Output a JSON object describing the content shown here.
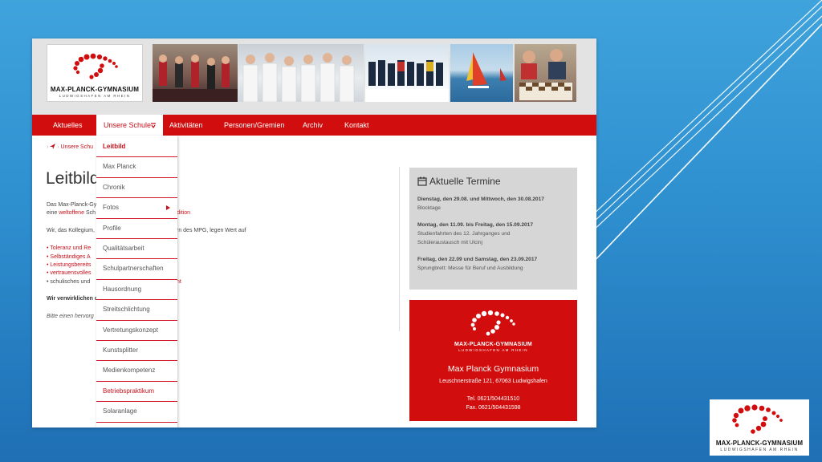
{
  "logo": {
    "name": "MAX-PLANCK-GYMNASIUM",
    "subtitle": "LUDWIGSHAFEN AM RHEIN"
  },
  "nav": {
    "items": [
      "Aktuelles",
      "Unsere Schule",
      "Aktivitäten",
      "Personen/Gremien",
      "Archiv",
      "Kontakt"
    ],
    "active": "Unsere Schule"
  },
  "breadcrumb": {
    "home_icon": "home-icon",
    "current": "Unsere Schu"
  },
  "main": {
    "title": "Leitbild",
    "intro_line1": "Das Max-Planck-Gy",
    "intro_line2_prefix": "eine",
    "intro_line2_link": "weltoffene",
    "intro_line2_rest": "Sch",
    "intro_line2_right": "er Tradition",
    "para2_left": "Wir, das Kollegium,",
    "para2_right": "rn des MPG, legen Wert auf",
    "bullets": [
      {
        "text": "Toleranz und Re",
        "red": true
      },
      {
        "text": "Selbständiges A",
        "red": true
      },
      {
        "text": "Leistungsbereits",
        "red": true
      },
      {
        "text": "vertrauensvolles",
        "red": true
      },
      {
        "text": "schulisches und",
        "red": false
      }
    ],
    "bullet_tail": "nt",
    "verwirklichen": "Wir verwirklichen c",
    "bitte": "Bitte einen hervorg"
  },
  "dropdown": {
    "items": [
      "Leitbild",
      "Max Planck",
      "Chronik",
      "Fotos",
      "Profile",
      "Qualitätsarbeit",
      "Schulpartnerschaften",
      "Hausordnung",
      "Streitschlichtung",
      "Vertretungskonzept",
      "Kunstsplitter",
      "Medienkompetenz",
      "Betriebspraktikum",
      "Solaranlage"
    ],
    "active": "Leitbild",
    "red_item": "Betriebspraktikum",
    "submenu_item": "Fotos"
  },
  "termine": {
    "title": "Aktuelle Termine",
    "icon": "calendar-icon",
    "entries": [
      {
        "date": "Dienstag, den 29.08. und Mittwoch, den 30.08.2017",
        "desc": [
          "Blocktage"
        ]
      },
      {
        "date": "Montag, den 11.09. bis Freitag, den 15.09.2017",
        "desc": [
          "Studienfahrten des 12. Jahrganges und",
          "Schüleraustausch mit Ulcinj"
        ]
      },
      {
        "date": "Freitag, den 22.09 und Samstag, den 23.09.2017",
        "desc": [
          "Sprungbrett: Messe für Beruf und Ausbildung"
        ]
      }
    ]
  },
  "contact": {
    "logo_name": "MAX-PLANCK-GYMNASIUM",
    "logo_sub": "LUDWIGSHAFEN AM RHEIN",
    "title": "Max Planck Gymnasium",
    "address": "Leuschnerstraße 121, 67063 Ludwigshafen",
    "tel": "Tel. 0621/504431510",
    "fax": "Fax. 0621/504431598"
  },
  "corner_logo": {
    "name": "MAX-PLANCK-GYMNASIUM",
    "subtitle": "LUDWIGSHAFEN AM RHEIN"
  },
  "colors": {
    "brand_red": "#d10d0d",
    "slide_blue": "#2e8fcf"
  }
}
